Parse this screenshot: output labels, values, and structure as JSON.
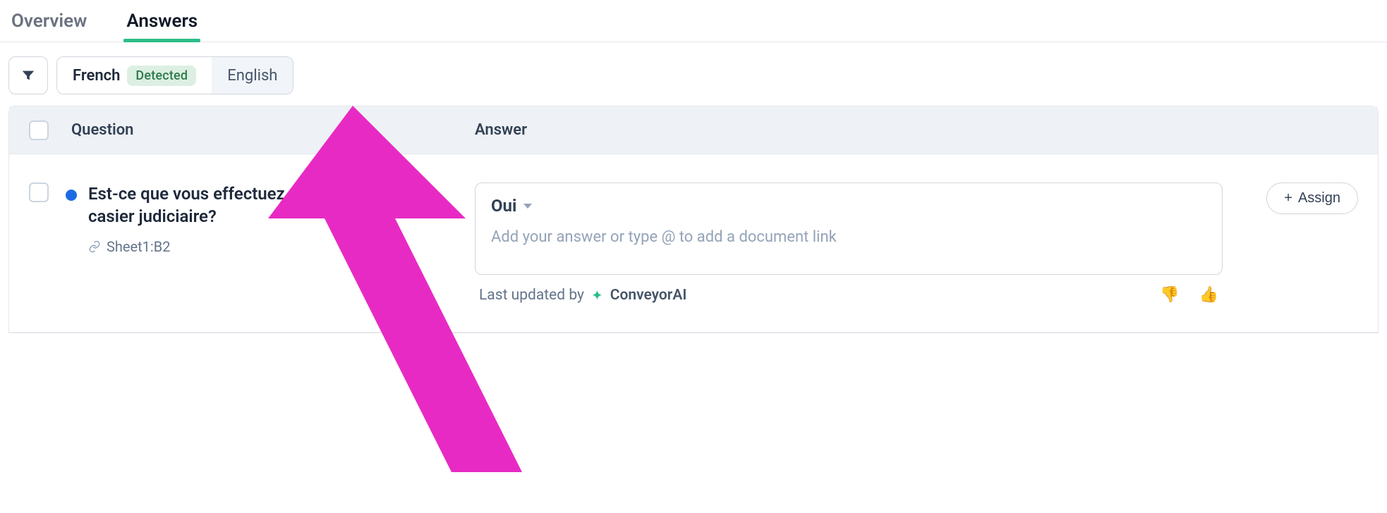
{
  "tabs": {
    "overview": "Overview",
    "answers": "Answers"
  },
  "toolbar": {
    "lang_primary": "French",
    "lang_badge": "Detected",
    "lang_secondary": "English"
  },
  "table": {
    "header_question": "Question",
    "header_answer": "Answer"
  },
  "row": {
    "question": "Est-ce que vous effectuez des vérifications de casier judiciaire?",
    "source_ref": "Sheet1:B2",
    "answer_value": "Oui",
    "answer_placeholder": "Add your answer or type @ to add a document link",
    "updated_prefix": "Last updated by",
    "updated_by": "ConveyorAI"
  },
  "assign": {
    "label": "Assign",
    "plus": "+"
  }
}
